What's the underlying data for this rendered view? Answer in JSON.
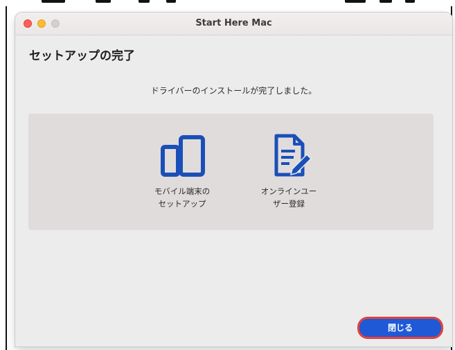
{
  "window": {
    "title": "Start Here Mac"
  },
  "page": {
    "heading": "セットアップの完了",
    "message": "ドライバーのインストールが完了しました。"
  },
  "tiles": [
    {
      "icon": "mobile-devices-icon",
      "label_line1": "モバイル端末の",
      "label_line2": "セットアップ"
    },
    {
      "icon": "registration-document-icon",
      "label_line1": "オンラインユー",
      "label_line2": "ザー登録"
    }
  ],
  "footer": {
    "close_label": "閉じる"
  },
  "colors": {
    "accent": "#1f59d6",
    "icon": "#1a4fb8",
    "highlight_ring": "#e8443a",
    "traffic_close": "#ff5f57",
    "traffic_min": "#febc2e",
    "traffic_zoom": "#d3d0d0"
  }
}
